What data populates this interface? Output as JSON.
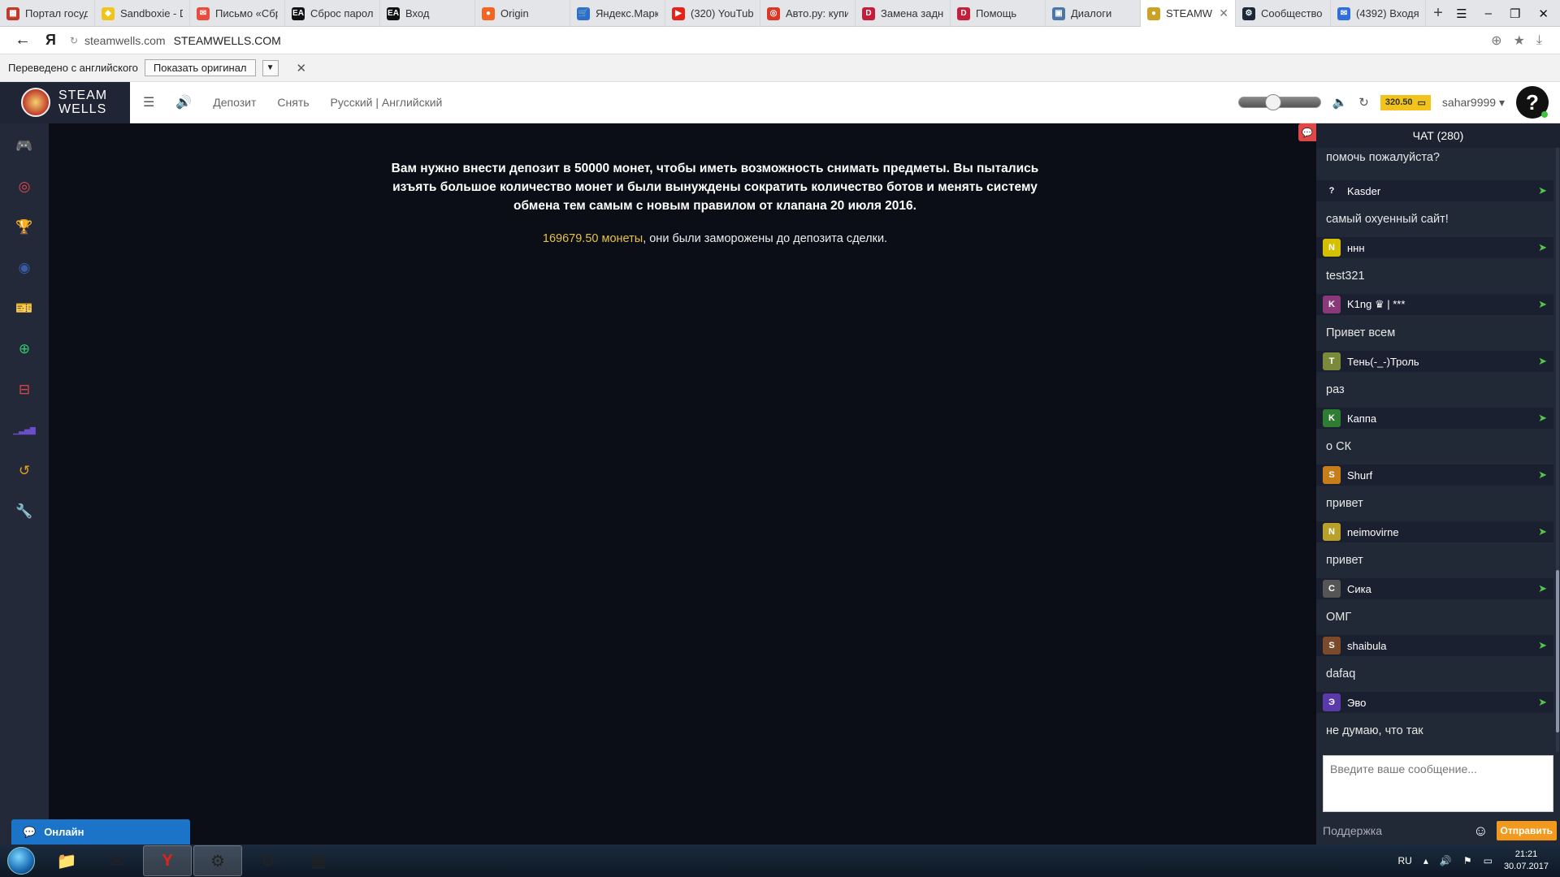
{
  "browser": {
    "tabs": [
      {
        "label": "Портал госуд",
        "icon": "gov-portal-icon",
        "color": "#c0392b",
        "glyph": "▦"
      },
      {
        "label": "Sandboxie - D",
        "icon": "sandboxie-icon",
        "color": "#f0c419",
        "glyph": "◆"
      },
      {
        "label": "Письмо «Сбр",
        "icon": "mail-icon",
        "color": "#e84c3d",
        "glyph": "✉"
      },
      {
        "label": "Сброс парол",
        "icon": "ea-icon",
        "color": "#111111",
        "glyph": "EA"
      },
      {
        "label": "Вход",
        "icon": "ea-icon",
        "color": "#111111",
        "glyph": "EA"
      },
      {
        "label": "Origin",
        "icon": "origin-icon",
        "color": "#f26522",
        "glyph": "●"
      },
      {
        "label": "Яндекс.Марк",
        "icon": "cart-icon",
        "color": "#2c6ecb",
        "glyph": "🛒"
      },
      {
        "label": "(320) YouTub",
        "icon": "youtube-icon",
        "color": "#e62117",
        "glyph": "▶"
      },
      {
        "label": "Авто.ру: купи",
        "icon": "autoru-icon",
        "color": "#db3727",
        "glyph": "◎"
      },
      {
        "label": "Замена задн",
        "icon": "d-icon",
        "color": "#c41e3a",
        "glyph": "D"
      },
      {
        "label": "Помощь",
        "icon": "d-icon",
        "color": "#c41e3a",
        "glyph": "D"
      },
      {
        "label": "Диалоги",
        "icon": "vk-icon",
        "color": "#4a76a8",
        "glyph": "▣"
      },
      {
        "label": "STEAMWE",
        "icon": "steamwells-icon",
        "color": "#c9a227",
        "glyph": "●",
        "active": true
      },
      {
        "label": "Сообщество",
        "icon": "steam-icon",
        "color": "#1b2838",
        "glyph": "⚙"
      },
      {
        "label": "(4392) Входя",
        "icon": "mail-icon",
        "color": "#2f6fd6",
        "glyph": "✉"
      }
    ],
    "url_host": "steamwells.com",
    "url_title": "STEAMWELLS.COM",
    "yandex_glyph": "Я"
  },
  "translate": {
    "label": "Переведено с английского",
    "show_original": "Показать оригинал"
  },
  "site": {
    "logo_line1": "STEAM",
    "logo_line2": "WELLS",
    "nav": {
      "deposit": "Депозит",
      "withdraw": "Снять",
      "languages": "Русский | Английский"
    },
    "balance": "320.50",
    "username": "sahar9999",
    "help_glyph": "?"
  },
  "sidebar": {
    "items": [
      {
        "name": "sidebar-item-games",
        "icon": "gamepad-icon",
        "glyph": "🎮",
        "color": "#e6a01e"
      },
      {
        "name": "sidebar-item-roulette",
        "icon": "target-icon",
        "glyph": "◎",
        "color": "#e04848"
      },
      {
        "name": "sidebar-item-trophy",
        "icon": "trophy-icon",
        "glyph": "🏆",
        "color": "#f1c40f"
      },
      {
        "name": "sidebar-item-radar",
        "icon": "radar-icon",
        "glyph": "◉",
        "color": "#3a5ca8"
      },
      {
        "name": "sidebar-item-tickets",
        "icon": "ticket-icon",
        "glyph": "🎫",
        "color": "#e6a01e"
      },
      {
        "name": "sidebar-item-deposit",
        "icon": "plus-circle-icon",
        "glyph": "⊕",
        "color": "#2ecc71"
      },
      {
        "name": "sidebar-item-withdraw",
        "icon": "minus-box-icon",
        "glyph": "⊟",
        "color": "#e04848"
      },
      {
        "name": "sidebar-item-stats",
        "icon": "signal-bars-icon",
        "glyph": "▁▃▅▇",
        "color": "#6a4fc9"
      },
      {
        "name": "sidebar-item-history",
        "icon": "history-icon",
        "glyph": "↺",
        "color": "#e6a01e"
      },
      {
        "name": "sidebar-item-settings",
        "icon": "wrench-icon",
        "glyph": "🔧",
        "color": "#d0d0d0"
      }
    ]
  },
  "main": {
    "message": "Вам нужно внести депозит в 50000 монет, чтобы иметь возможность снимать предметы. Вы пытались изъять большое количество монет и были вынуждены сократить количество ботов и менять систему обмена тем самым с новым правилом от клапана 20 июля 2016.",
    "frozen_coins": "169679.50 монеты",
    "frozen_rest": ", они были заморожены до депозита сделки."
  },
  "chat": {
    "title": "ЧАТ (280)",
    "first_message": "помочь пожалуйста?",
    "messages": [
      {
        "user": "Kasder",
        "text": "самый охуенный сайт!",
        "avatar_color": "#1a2030",
        "avatar_glyph": "?"
      },
      {
        "user": "ннн",
        "text": "test321",
        "avatar_color": "#d4c000",
        "avatar_glyph": "N"
      },
      {
        "user": "K1ng ♛ | ***",
        "text": "Привет всем",
        "avatar_color": "#8a3a7a",
        "avatar_glyph": "K"
      },
      {
        "user": "Тень(-_-)Троль",
        "text": "раз",
        "avatar_color": "#7a8a3a",
        "avatar_glyph": "T"
      },
      {
        "user": "Каппа",
        "text": "о СК",
        "avatar_color": "#2e7d32",
        "avatar_glyph": "K"
      },
      {
        "user": "Shurf",
        "text": "привет",
        "avatar_color": "#c77d1a",
        "avatar_glyph": "S"
      },
      {
        "user": "neimovirne",
        "text": "привет",
        "avatar_color": "#b8a02a",
        "avatar_glyph": "N"
      },
      {
        "user": "Сика",
        "text": "ОМГ",
        "avatar_color": "#555555",
        "avatar_glyph": "C"
      },
      {
        "user": "shaibula",
        "text": "dafaq",
        "avatar_color": "#7a4a2a",
        "avatar_glyph": "S"
      },
      {
        "user": "Эво",
        "text": "не думаю, что так",
        "avatar_color": "#5a3aa8",
        "avatar_glyph": "Э"
      }
    ],
    "input_placeholder": "Введите ваше сообщение...",
    "support": "Поддержка",
    "send": "Отправить"
  },
  "online_widget": {
    "label": "Онлайн"
  },
  "taskbar": {
    "lang": "RU",
    "time": "21:21",
    "date": "30.07.2017"
  },
  "colors": {
    "accent": "#f39a1e",
    "coins": "#e6c24a",
    "online_blue": "#1c74c9",
    "send_green": "#54c64a"
  }
}
